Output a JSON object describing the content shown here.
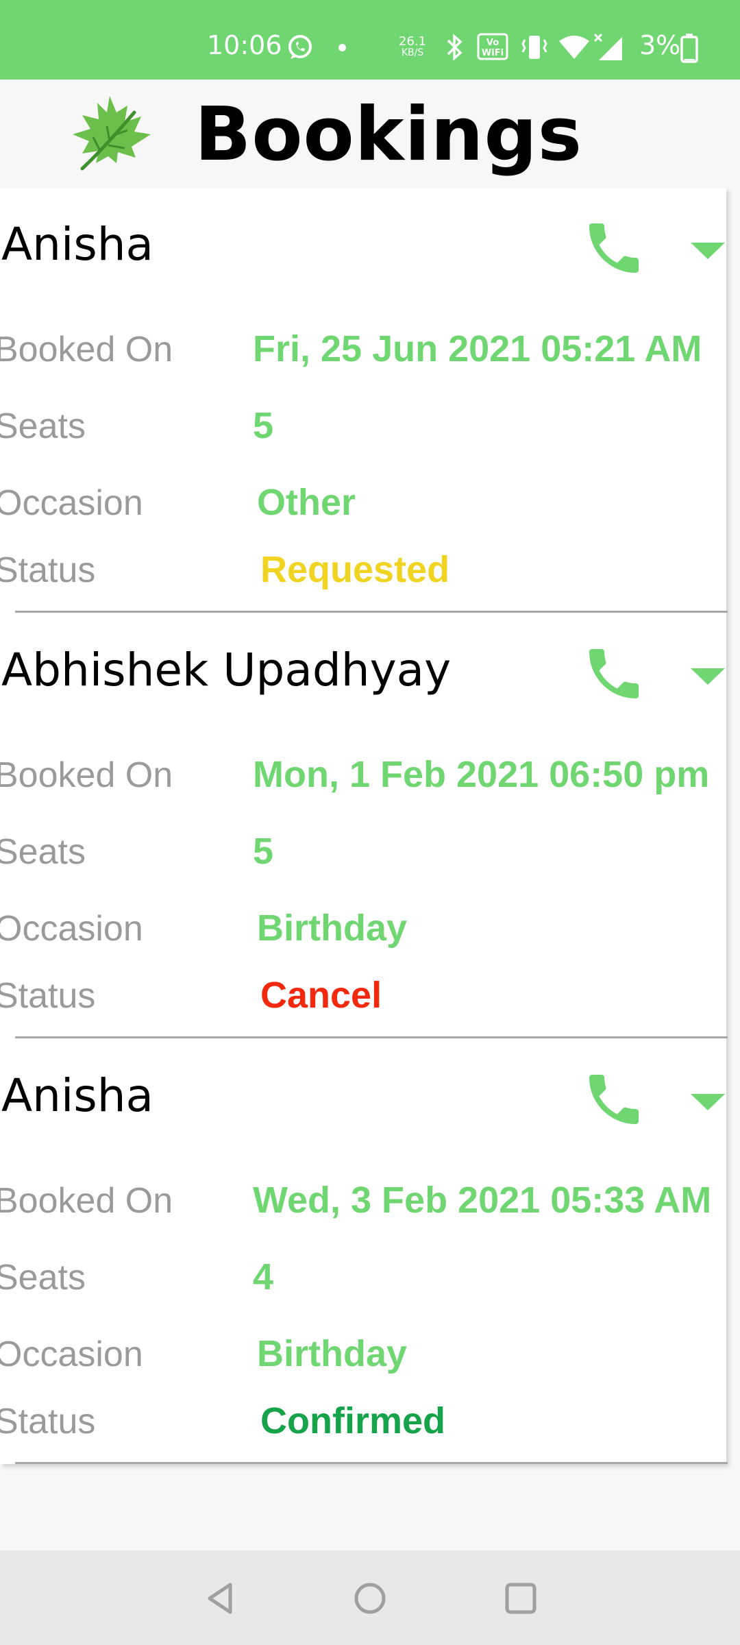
{
  "status_bar": {
    "time": "10:06",
    "speed_value": "26.1",
    "speed_unit": "KB/S",
    "battery": "3%",
    "icons": [
      "whatsapp-icon",
      "bluetooth-icon",
      "vowifi-icon",
      "vibrate-icon",
      "wifi-icon",
      "signal-icon",
      "battery-icon"
    ]
  },
  "header": {
    "title": "Bookings",
    "logo": "maple-leaf-logo"
  },
  "labels": {
    "booked_on": "Booked On",
    "seats": "Seats",
    "occasion": "Occasion",
    "status": "Status"
  },
  "colors": {
    "accent": "#6fd671",
    "requested": "#f1d322",
    "cancel": "#f2290f",
    "confirmed": "#16a34a",
    "label": "#9a9a9a"
  },
  "bookings": [
    {
      "name": "Anisha",
      "booked_on": "Fri, 25 Jun 2021 05:21 AM",
      "seats": "5",
      "occasion": "Other",
      "status": "Requested"
    },
    {
      "name": "Abhishek Upadhyay",
      "booked_on": "Mon, 1 Feb 2021 06:50 pm",
      "seats": "5",
      "occasion": "Birthday",
      "status": "Cancel"
    },
    {
      "name": "Anisha",
      "booked_on": "Wed, 3 Feb 2021 05:33 AM",
      "seats": "4",
      "occasion": "Birthday",
      "status": "Confirmed"
    }
  ],
  "nav": {
    "icons": [
      "back-icon",
      "home-icon",
      "recents-icon"
    ]
  }
}
